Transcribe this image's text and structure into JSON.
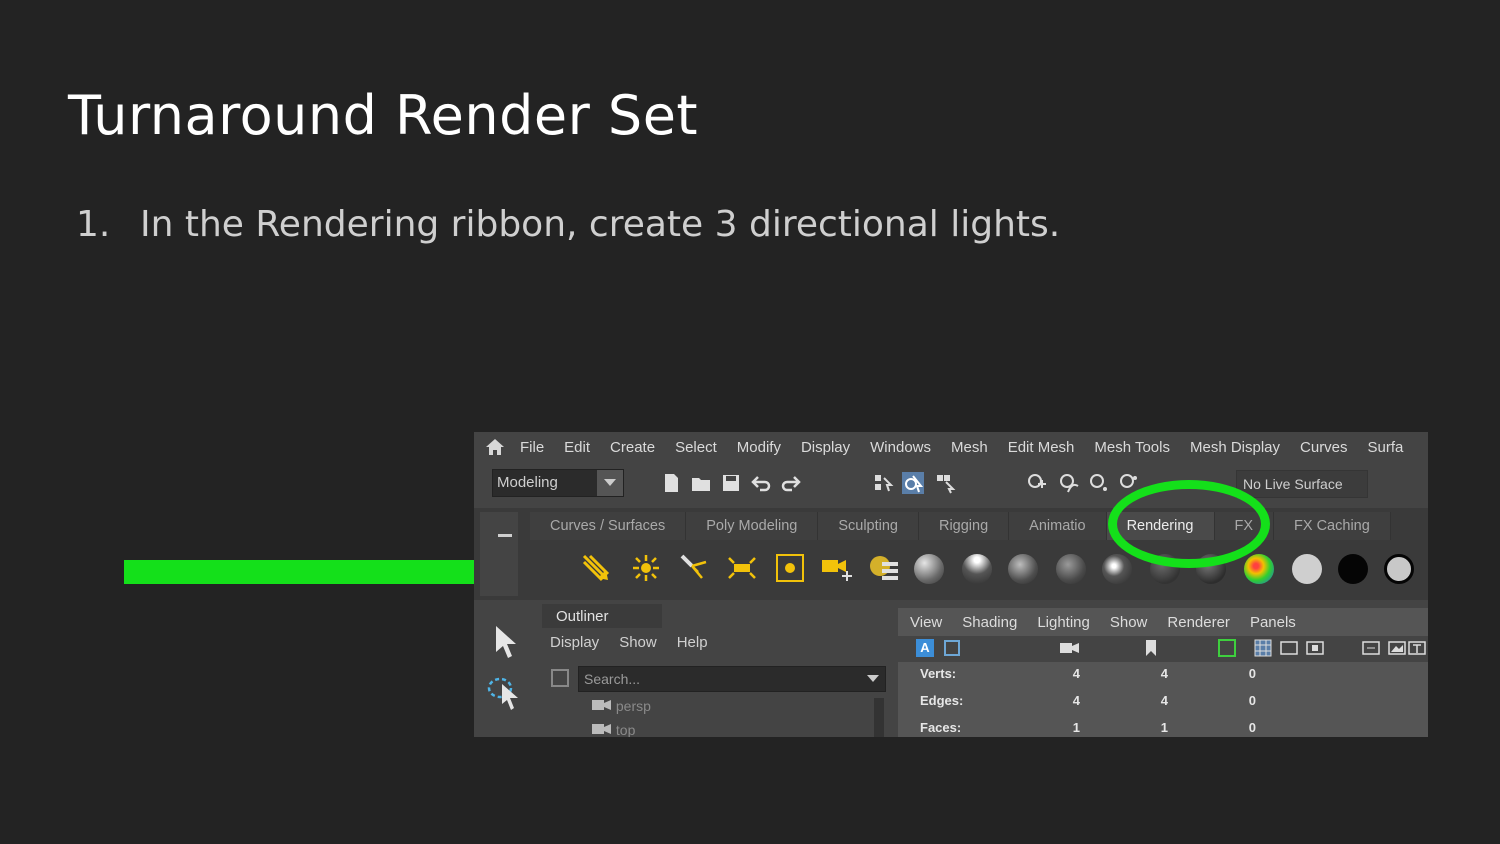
{
  "slide": {
    "title": "Turnaround Render Set",
    "bullet_number": "1.",
    "bullet_text": "In the Rendering ribbon, create 3 directional lights."
  },
  "colors": {
    "background": "#232323",
    "arrow": "#14e01a",
    "highlight": "#14e01a"
  },
  "maya": {
    "menu": [
      "File",
      "Edit",
      "Create",
      "Select",
      "Modify",
      "Display",
      "Windows",
      "Mesh",
      "Edit Mesh",
      "Mesh Tools",
      "Mesh Display",
      "Curves",
      "Surfa"
    ],
    "mode": "Modeling",
    "live_surface": "No Live Surface",
    "shelf_tabs": [
      "Curves / Surfaces",
      "Poly Modeling",
      "Sculpting",
      "Rigging",
      "Animatio",
      "Rendering",
      "FX",
      "FX Caching"
    ],
    "active_tab": "Rendering",
    "outliner": {
      "title": "Outliner",
      "menu": [
        "Display",
        "Show",
        "Help"
      ],
      "search_placeholder": "Search...",
      "items": [
        "persp",
        "top"
      ]
    },
    "viewport": {
      "menu": [
        "View",
        "Shading",
        "Lighting",
        "Show",
        "Renderer",
        "Panels"
      ],
      "stats": [
        {
          "label": "Verts:",
          "a": "4",
          "b": "4",
          "c": "0"
        },
        {
          "label": "Edges:",
          "a": "4",
          "b": "4",
          "c": "0"
        },
        {
          "label": "Faces:",
          "a": "1",
          "b": "1",
          "c": "0"
        }
      ]
    }
  }
}
